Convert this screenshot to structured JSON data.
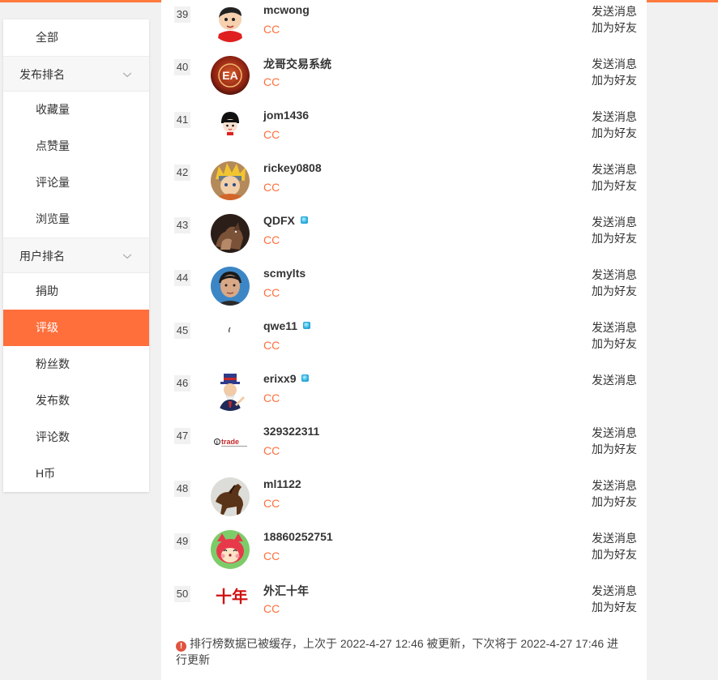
{
  "colors": {
    "accent": "#ff6f3c",
    "tag": "#ff6f3c",
    "notice_icon": "#e0533f"
  },
  "sidebar": {
    "items": [
      {
        "label": "全部",
        "type": "item"
      },
      {
        "label": "发布排名",
        "type": "group"
      },
      {
        "label": "收藏量",
        "type": "item"
      },
      {
        "label": "点赞量",
        "type": "item"
      },
      {
        "label": "评论量",
        "type": "item"
      },
      {
        "label": "浏览量",
        "type": "item"
      },
      {
        "label": "用户排名",
        "type": "group"
      },
      {
        "label": "捐助",
        "type": "item"
      },
      {
        "label": "评级",
        "type": "item",
        "active": true
      },
      {
        "label": "粉丝数",
        "type": "item"
      },
      {
        "label": "发布数",
        "type": "item"
      },
      {
        "label": "评论数",
        "type": "item"
      },
      {
        "label": "H币",
        "type": "item"
      }
    ]
  },
  "ranking": {
    "rows": [
      {
        "rank": "39",
        "name": "mcwong",
        "tag": "CC",
        "vip": false,
        "msg": "发送消息",
        "friend": "加为好友",
        "avatar": "cartoon-boy"
      },
      {
        "rank": "40",
        "name": "龙哥交易系统",
        "tag": "CC",
        "vip": false,
        "msg": "发送消息",
        "friend": "加为好友",
        "avatar": "ea-logo"
      },
      {
        "rank": "41",
        "name": "jom1436",
        "tag": "CC",
        "vip": false,
        "msg": "发送消息",
        "friend": "加为好友",
        "avatar": "cartoon-girl"
      },
      {
        "rank": "42",
        "name": "rickey0808",
        "tag": "CC",
        "vip": false,
        "msg": "发送消息",
        "friend": "加为好友",
        "avatar": "anime-ninja"
      },
      {
        "rank": "43",
        "name": "QDFX",
        "tag": "CC",
        "vip": true,
        "msg": "发送消息",
        "friend": "加为好友",
        "avatar": "horses-dark"
      },
      {
        "rank": "44",
        "name": "scmylts",
        "tag": "CC",
        "vip": false,
        "msg": "发送消息",
        "friend": "加为好友",
        "avatar": "man-photo"
      },
      {
        "rank": "45",
        "name": "qwe11",
        "tag": "CC",
        "vip": true,
        "msg": "发送消息",
        "friend": "加为好友",
        "avatar": "blank"
      },
      {
        "rank": "46",
        "name": "erixx9",
        "tag": "CC",
        "vip": true,
        "msg": "发送消息",
        "friend": "",
        "avatar": "uncle-sam"
      },
      {
        "rank": "47",
        "name": "329322311",
        "tag": "CC",
        "vip": false,
        "msg": "发送消息",
        "friend": "加为好友",
        "avatar": "jtrade-logo"
      },
      {
        "rank": "48",
        "name": "ml1122",
        "tag": "CC",
        "vip": false,
        "msg": "发送消息",
        "friend": "加为好友",
        "avatar": "horse"
      },
      {
        "rank": "49",
        "name": "18860252751",
        "tag": "CC",
        "vip": false,
        "msg": "发送消息",
        "friend": "加为好友",
        "avatar": "red-fox"
      },
      {
        "rank": "50",
        "name": "外汇十年",
        "tag": "CC",
        "vip": false,
        "msg": "发送消息",
        "friend": "加为好友",
        "avatar": "calligraphy"
      }
    ]
  },
  "notice": {
    "text": "排行榜数据已被缓存，上次于 2022-4-27 12:46 被更新，下次将于 2022-4-27 17:46 进行更新",
    "icon": "exclamation-icon"
  },
  "avatar_text": {
    "ea": "EA",
    "jtrade": "trade",
    "calligraphy": "十年"
  }
}
